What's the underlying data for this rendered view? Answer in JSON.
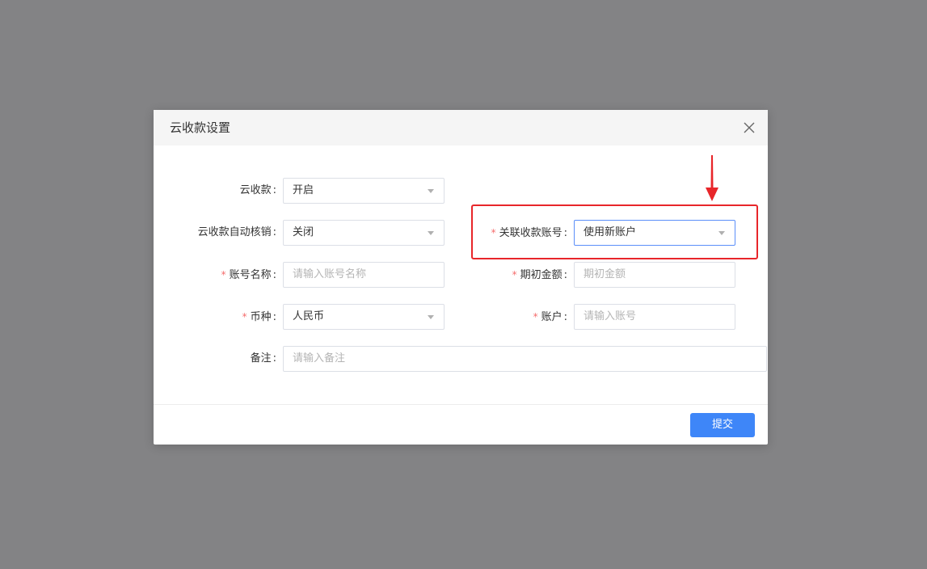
{
  "dialog": {
    "title": "云收款设置",
    "close_icon": "close-icon",
    "submit_label": "提交"
  },
  "form": {
    "colon": ":",
    "required_mark": "*",
    "cloud_receipt": {
      "label": "云收款",
      "value": "开启",
      "required": false
    },
    "auto_writeoff": {
      "label": "云收款自动核销",
      "value": "关闭",
      "required": false
    },
    "linked_account": {
      "label": "关联收款账号",
      "value": "使用新账户",
      "required": true
    },
    "account_name": {
      "label": "账号名称",
      "placeholder": "请输入账号名称",
      "required": true
    },
    "opening_amount": {
      "label": "期初金额",
      "placeholder": "期初金额",
      "required": true
    },
    "currency": {
      "label": "币种",
      "value": "人民币",
      "required": true
    },
    "account": {
      "label": "账户",
      "placeholder": "请输入账号",
      "required": true
    },
    "remark": {
      "label": "备注",
      "placeholder": "请输入备注",
      "required": false
    }
  },
  "colors": {
    "overlay": "#838385",
    "primary": "#3e86f8",
    "required": "#f56c6c",
    "annotation": "#e8262a"
  }
}
